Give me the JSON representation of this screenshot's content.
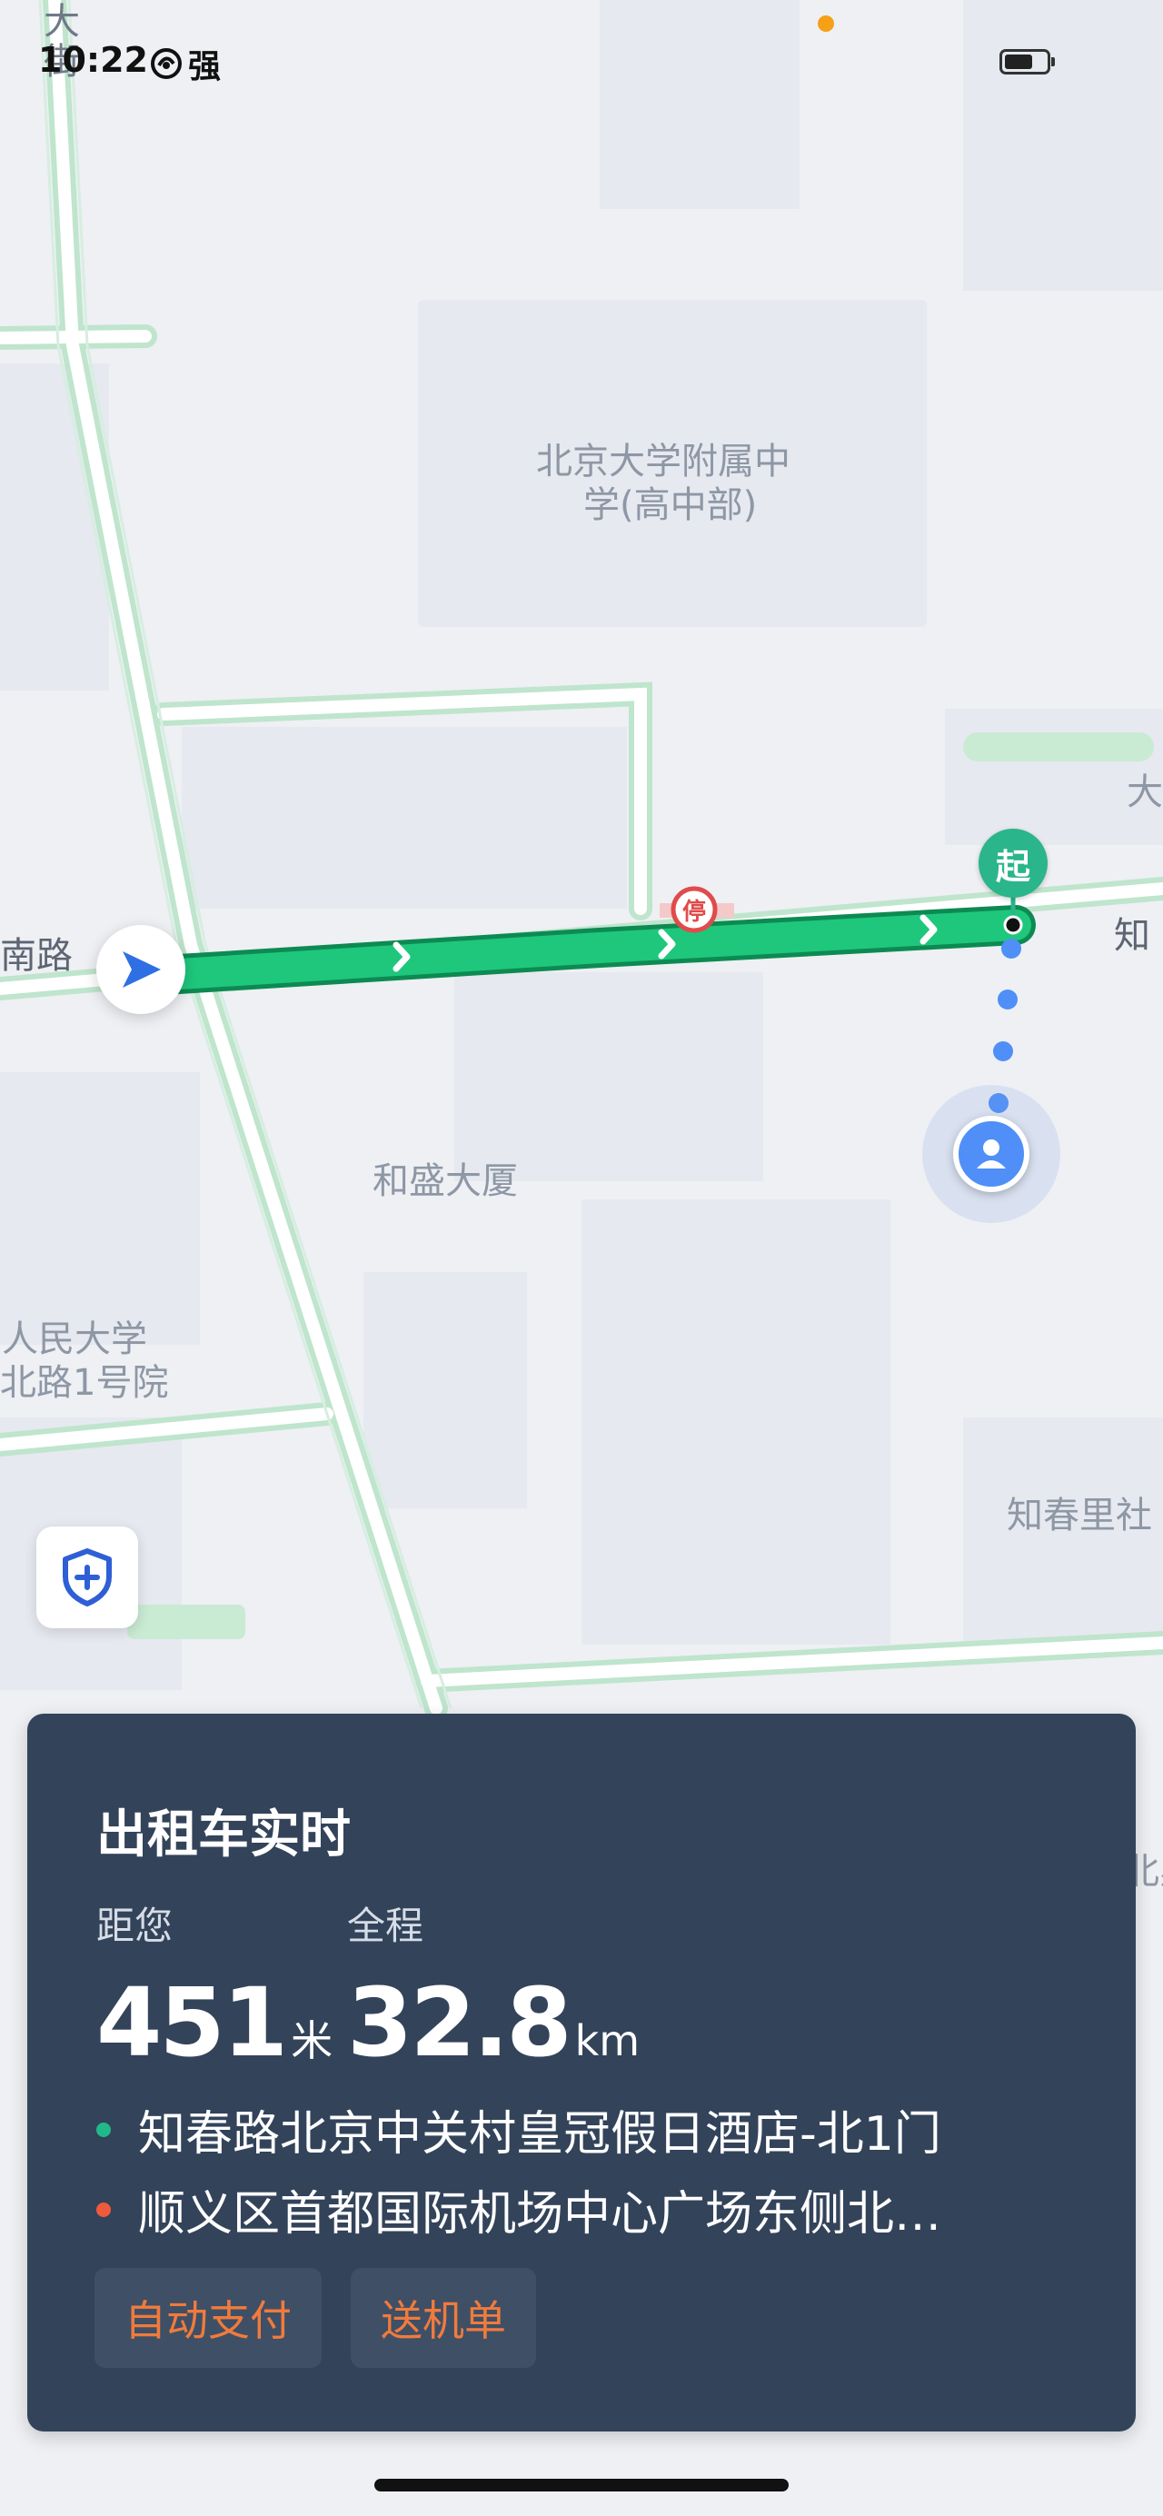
{
  "status_bar": {
    "time": "10:22",
    "network_label": "强"
  },
  "map": {
    "labels": {
      "school": "北京大学附属中",
      "school_line2": "学(高中部)",
      "building": "和盛大厦",
      "campus_line1": "人民大学",
      "campus_line2": "北路1号院",
      "community": "知春里社",
      "road_left": "南路",
      "road_right": "知",
      "top_left_line1": "大",
      "top_left_line2": "街",
      "right_edge": "大",
      "card_peek": "北星"
    },
    "stop_sign": "停",
    "start_marker": "起",
    "route_color": "#1ec77c"
  },
  "card": {
    "title": "出租车实时",
    "distance_label": "距您",
    "distance_value": "451",
    "distance_unit": "米",
    "total_label": "全程",
    "total_value": "32.8",
    "total_unit": "km",
    "pickup": "知春路北京中关村皇冠假日酒店-北1门",
    "dropoff": "顺义区首都国际机场中心广场东侧北…",
    "tags": [
      "自动支付",
      "送机单"
    ],
    "pickup_color": "#21b98a",
    "dropoff_color": "#f05a3c"
  },
  "icons": {
    "nav": "navigation-arrow-icon",
    "user": "user-location-icon",
    "shield": "safety-shield-icon"
  }
}
